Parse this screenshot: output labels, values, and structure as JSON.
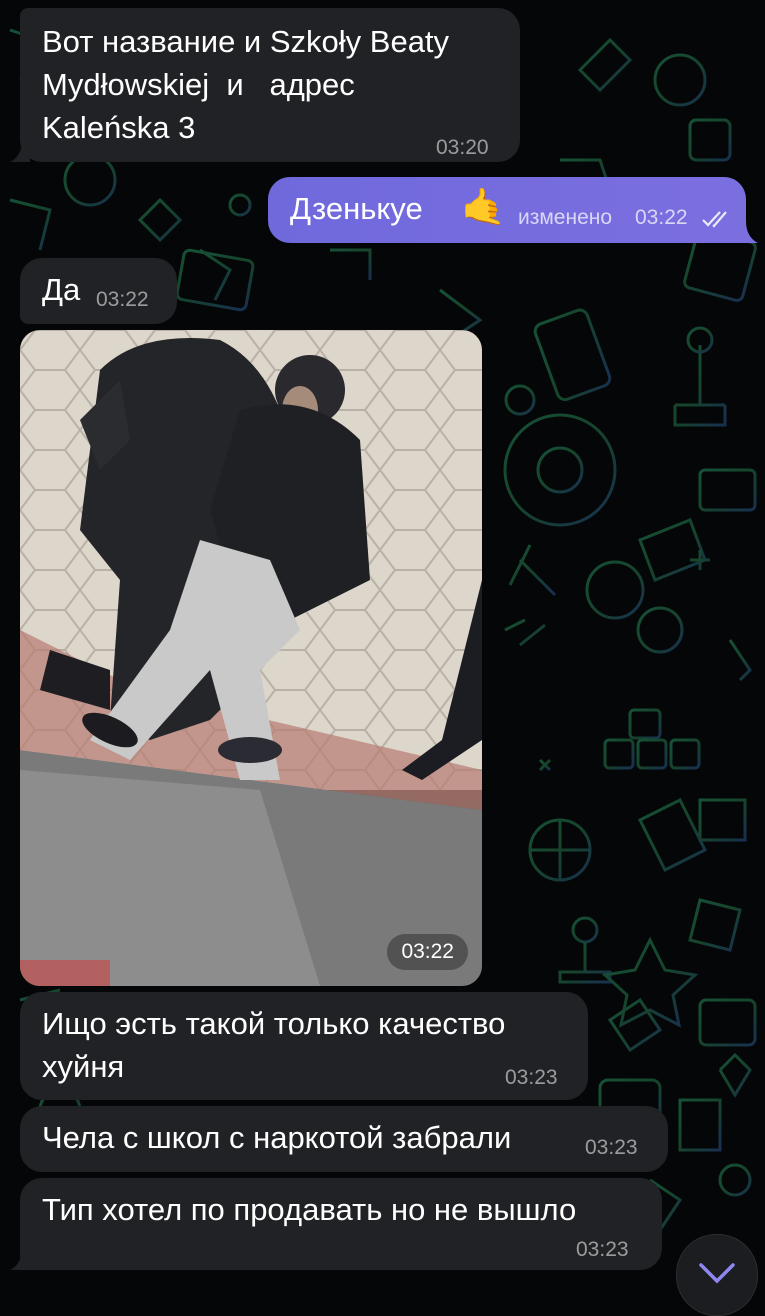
{
  "messages": [
    {
      "text": "Вот название и Szkoły Beaty\nMydłowskiej  и   адрес\nKaleńska 3",
      "time": "03:20"
    },
    {
      "text": "Дзенькуе",
      "emoji": "🤙",
      "edited": "изменено",
      "time": "03:22"
    },
    {
      "text": "Да",
      "time": "03:22"
    },
    {
      "photo_time": "03:22"
    },
    {
      "text": "Ищо эсть такой только качество\nхуйня",
      "time": "03:23"
    },
    {
      "text": "Чела с школ с наркотой забрали",
      "time": "03:23"
    },
    {
      "text": "Тип хотел по продавать но не вышло",
      "time": "03:23"
    }
  ],
  "colors": {
    "incoming_bubble": "#212225",
    "outgoing_bubble": "#7068dd",
    "background": "#050607",
    "wallpaper_accent": "#1f6b3a"
  },
  "icons": {
    "read_status": "double-check-icon",
    "scroll_down": "chevron-down-icon"
  }
}
